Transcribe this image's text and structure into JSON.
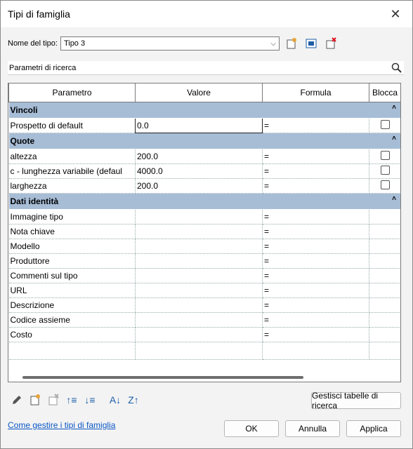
{
  "window": {
    "title": "Tipi di famiglia"
  },
  "type_row": {
    "label": "Nome del tipo:",
    "value": "Tipo 3"
  },
  "search": {
    "placeholder": "Parametri di ricerca"
  },
  "table": {
    "headers": [
      "Parametro",
      "Valore",
      "Formula",
      "Blocca"
    ],
    "groups": [
      {
        "name": "Vincoli",
        "rows": [
          {
            "param": "Prospetto di default",
            "value": "0.0",
            "formula": "=",
            "lock": true
          }
        ]
      },
      {
        "name": "Quote",
        "rows": [
          {
            "param": "altezza",
            "value": "200.0",
            "formula": "=",
            "lock": true
          },
          {
            "param": "c - lunghezza variabile (defaul",
            "value": "4000.0",
            "formula": "=",
            "lock": true
          },
          {
            "param": "larghezza",
            "value": "200.0",
            "formula": "=",
            "lock": true
          }
        ]
      },
      {
        "name": "Dati identità",
        "rows": [
          {
            "param": "Immagine tipo",
            "value": "",
            "formula": "="
          },
          {
            "param": "Nota chiave",
            "value": "",
            "formula": "="
          },
          {
            "param": "Modello",
            "value": "",
            "formula": "="
          },
          {
            "param": "Produttore",
            "value": "",
            "formula": "="
          },
          {
            "param": "Commenti sul tipo",
            "value": "",
            "formula": "="
          },
          {
            "param": "URL",
            "value": "",
            "formula": "="
          },
          {
            "param": "Descrizione",
            "value": "",
            "formula": "="
          },
          {
            "param": "Codice assieme",
            "value": "",
            "formula": "="
          },
          {
            "param": "Costo",
            "value": "",
            "formula": "="
          }
        ]
      }
    ]
  },
  "buttons": {
    "lookup_tables": "Gestisci tabelle di ricerca",
    "ok": "OK",
    "cancel": "Annulla",
    "apply": "Applica"
  },
  "help_link": "Come gestire i tipi di famiglia",
  "colors": {
    "group_header": "#a7bdd6",
    "accent_icon": "#1d5ea8",
    "link": "#0b57c6"
  }
}
